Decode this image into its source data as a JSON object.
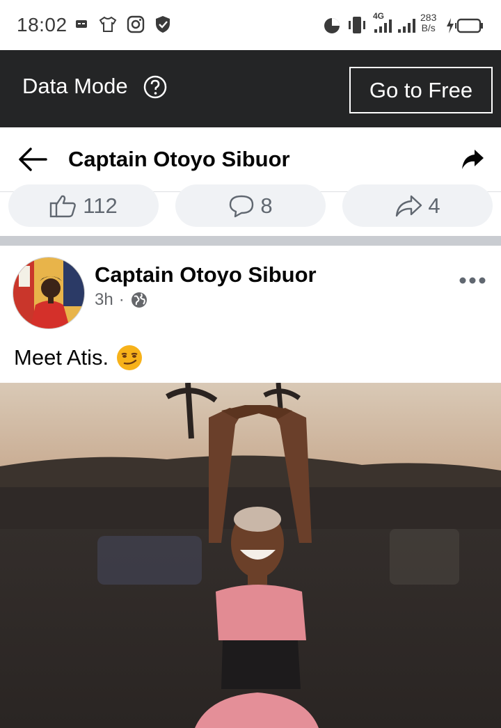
{
  "status_bar": {
    "time": "18:02",
    "net_speed_value": "283",
    "net_speed_unit": "B/s",
    "network_type": "4G"
  },
  "data_mode": {
    "label": "Data Mode",
    "go_free_label": "Go to Free"
  },
  "header": {
    "title": "Captain Otoyo Sibuor"
  },
  "reactions": {
    "likes": "112",
    "comments": "8",
    "shares": "4"
  },
  "post": {
    "author": "Captain Otoyo Sibuor",
    "time": "3h",
    "separator": "·",
    "text": "Meet Atis."
  }
}
